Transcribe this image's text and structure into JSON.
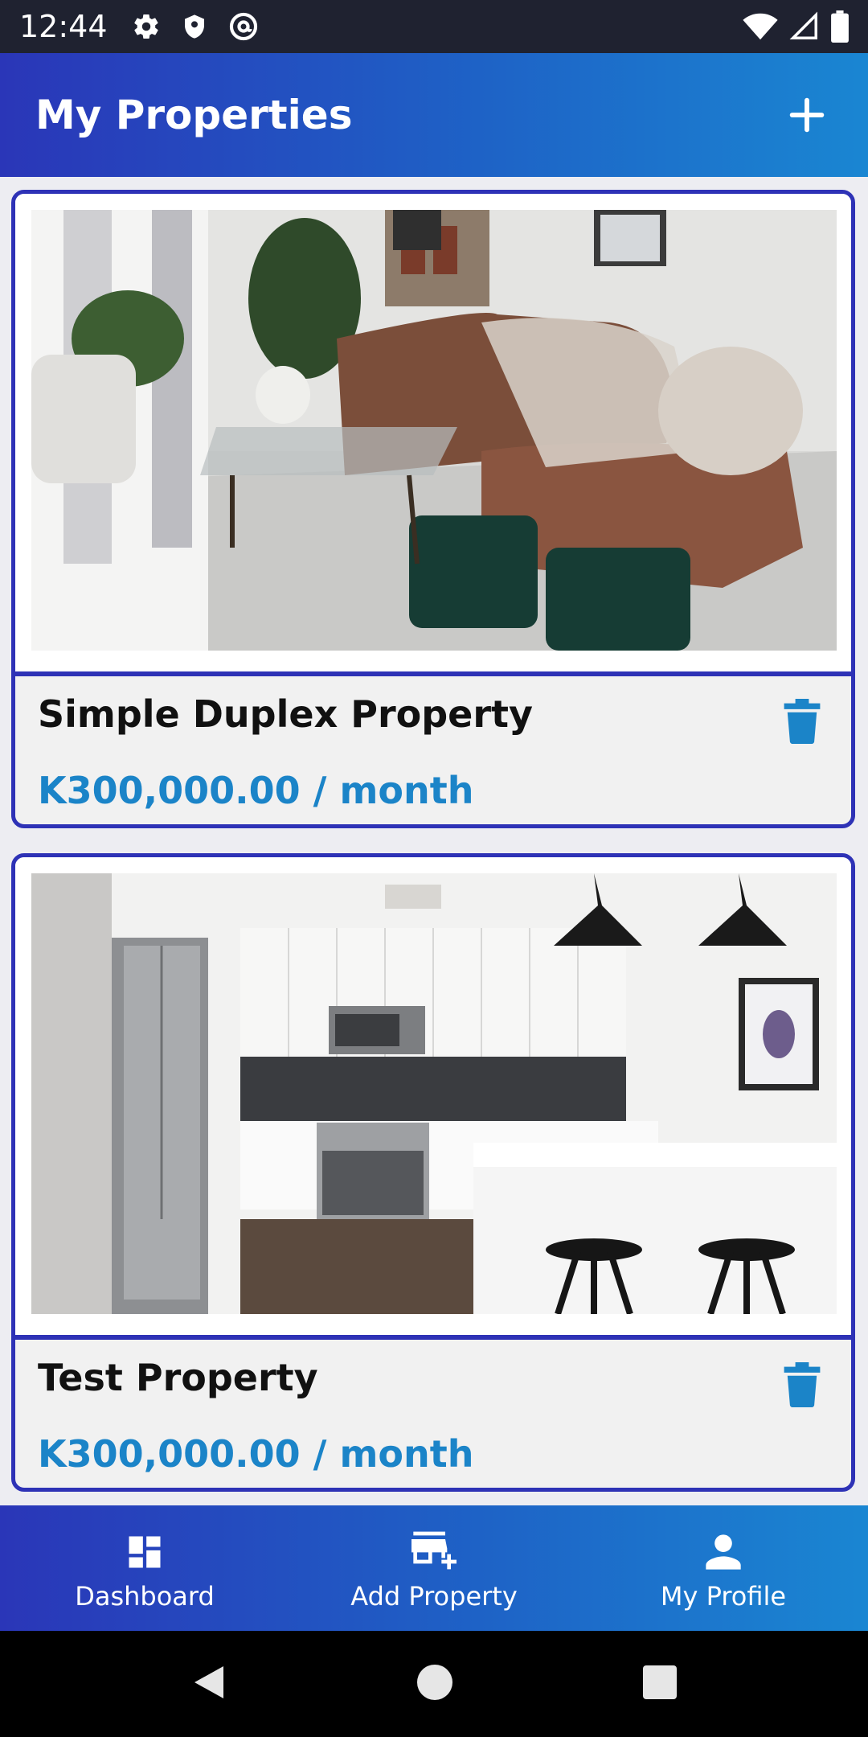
{
  "status_bar": {
    "time": "12:44"
  },
  "app_bar": {
    "title": "My Properties"
  },
  "properties": [
    {
      "title": "Simple Duplex Property",
      "price": "K300,000.00 / month"
    },
    {
      "title": "Test Property",
      "price": "K300,000.00 / month"
    }
  ],
  "bottom_nav": [
    {
      "label": "Dashboard",
      "icon": "dashboard-icon"
    },
    {
      "label": "Add Property",
      "icon": "add-store-icon"
    },
    {
      "label": "My Profile",
      "icon": "person-icon"
    }
  ],
  "colors": {
    "accent_blue": "#1b84c8",
    "card_border": "#2e32b6",
    "app_bar_start": "#2a36b8",
    "app_bar_end": "#1a86d2"
  }
}
